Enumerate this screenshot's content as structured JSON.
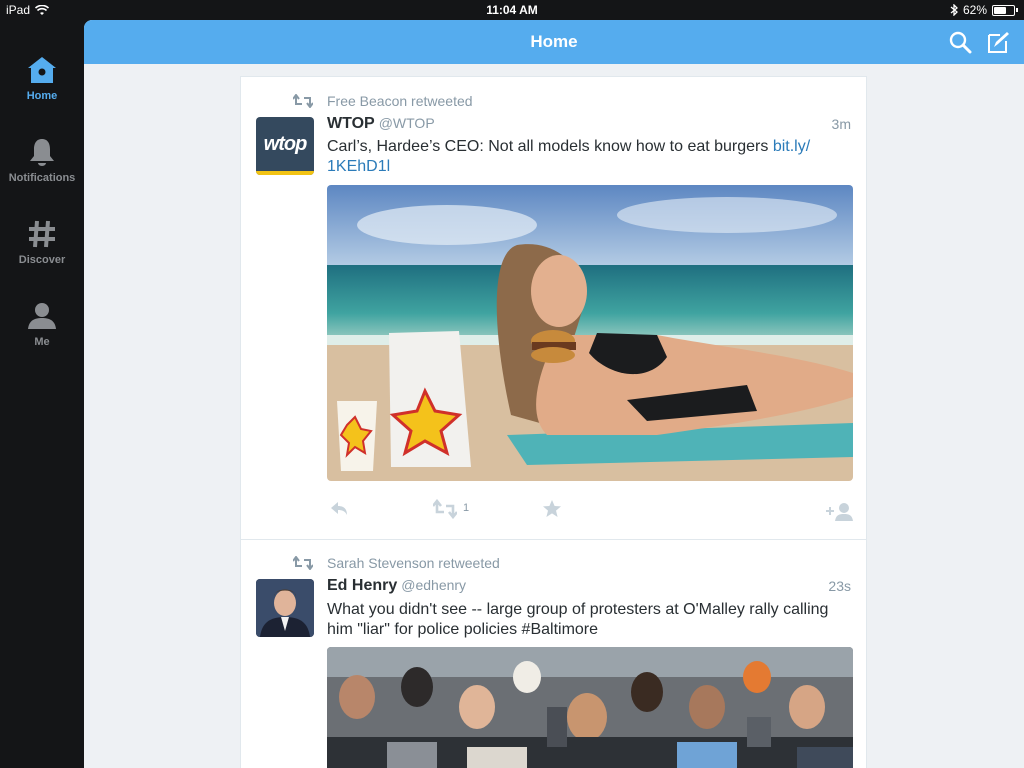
{
  "status": {
    "device": "iPad",
    "time": "11:04 AM",
    "battery": "62%",
    "battery_level": 0.62
  },
  "sidebar": {
    "items": [
      {
        "label": "Home",
        "icon": "home-icon",
        "active": true
      },
      {
        "label": "Notifications",
        "icon": "bell-icon",
        "active": false
      },
      {
        "label": "Discover",
        "icon": "hashtag-icon",
        "active": false
      },
      {
        "label": "Me",
        "icon": "person-icon",
        "active": false
      }
    ]
  },
  "header": {
    "title": "Home",
    "search_icon": "search-icon",
    "compose_icon": "compose-icon"
  },
  "colors": {
    "accent": "#55acee",
    "link": "#2b7bb9",
    "sidebar_bg": "#141517",
    "muted": "#8899a6"
  },
  "tweets": [
    {
      "retweeted_by": "Free Beacon retweeted",
      "avatar_text": "wtop",
      "name": "WTOP",
      "handle": "@WTOP",
      "time": "3m",
      "text": "Carl’s, Hardee’s CEO: Not all models know how to eat burgers ",
      "link": "bit.ly/\n1KEhD1l",
      "media": "photo of a model in a bikini holding a burger on a beach",
      "retweet_count": "1"
    },
    {
      "retweeted_by": "Sarah Stevenson retweeted",
      "name": "Ed Henry",
      "handle": "@edhenry",
      "time": "23s",
      "text": "What you didn't see -- large group of protesters at O'Malley rally calling him \"liar\" for police policies #Baltimore",
      "media": "photo of a crowd of photographers and protesters"
    }
  ]
}
